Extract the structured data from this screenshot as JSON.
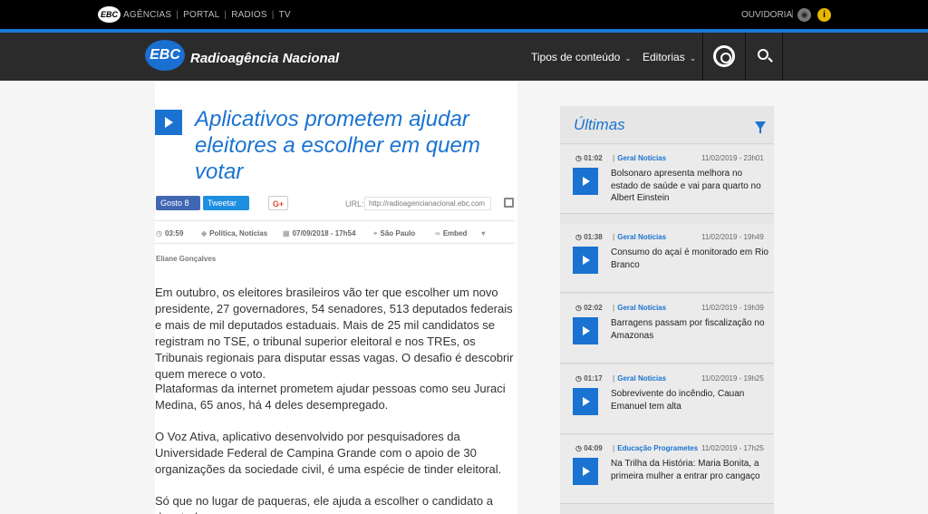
{
  "topbar": {
    "logo": "EBC",
    "links": [
      "AGÊNCIAS",
      "PORTAL",
      "RADIOS",
      "TV"
    ],
    "ouvidoria": "OUVIDORIA"
  },
  "header": {
    "logo_badge": "EBC",
    "site_name": "Radioagência Nacional",
    "nav": [
      "Tipos de conteúdo",
      "Editorias"
    ]
  },
  "article": {
    "title": "Aplicativos prometem ajudar eleitores a escolher em quem votar",
    "share": {
      "facebook": "Gosto 8",
      "twitter": "Tweetar",
      "gplus": "G+"
    },
    "url_label": "URL:",
    "url_value": "http://radioagencianacional.ebc.com",
    "meta": {
      "duration": "03:59",
      "tags": "Política, Notícias",
      "datetime": "07/09/2018 - 17h54",
      "location": "São Paulo",
      "embed": "Embed"
    },
    "author": "Eliane Gonçalves",
    "paragraphs": [
      "Em outubro, os eleitores brasileiros vão ter que escolher um novo presidente, 27 governadores, 54 senadores, 513 deputados federais e mais de mil deputados estaduais. Mais de 25 mil candidatos se registram no TSE, o tribunal superior eleitoral e nos TREs, os Tribunais regionais para disputar essas vagas. O desafio é descobrir quem merece o voto.",
      "Plataformas da internet prometem ajudar pessoas como seu Juraci Medina, 65 anos, há 4 deles desempregado.",
      "O Voz Ativa, aplicativo desenvolvido por pesquisadores da Universidade Federal de Campina Grande com o apoio de 30 organizações da sociedade civil, é uma espécie de tinder eleitoral.",
      "Só que no lugar de paqueras, ele ajuda a escolher o candidato a deputado"
    ]
  },
  "sidebar": {
    "title": "Últimas",
    "items": [
      {
        "duration": "01:02",
        "cat1": "Geral",
        "cat2": "Notícias",
        "date": "11/02/2019 - 23h01",
        "headline": "Bolsonaro apresenta melhora no estado de saúde e vai para quarto no Albert Einstein"
      },
      {
        "duration": "01:38",
        "cat1": "Geral",
        "cat2": "Notícias",
        "date": "11/02/2019 - 19h49",
        "headline": "Consumo do açaí é monitorado em Rio Branco"
      },
      {
        "duration": "02:02",
        "cat1": "Geral",
        "cat2": "Notícias",
        "date": "11/02/2019 - 19h39",
        "headline": "Barragens passam por fiscalização no Amazonas"
      },
      {
        "duration": "01:17",
        "cat1": "Geral",
        "cat2": "Notícias",
        "date": "11/02/2019 - 19h25",
        "headline": "Sobrevivente do incêndio, Cauan Emanuel tem alta"
      },
      {
        "duration": "04:09",
        "cat1": "Educação",
        "cat2": "Programetes",
        "date": "11/02/2019 - 17h25",
        "headline": "Na Trilha da História: Maria Bonita, a primeira mulher a entrar pro cangaço"
      }
    ]
  }
}
